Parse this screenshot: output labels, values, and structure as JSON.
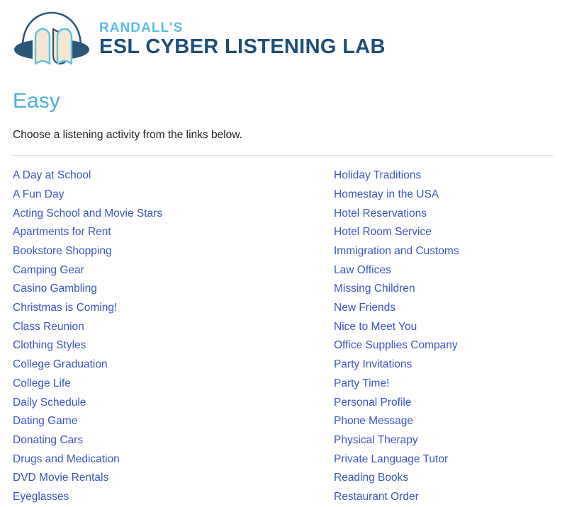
{
  "header": {
    "logo_icon": "headphones-books-logo",
    "brand_top": "RANDALL'S",
    "brand_main": "ESL CYBER LISTENING LAB",
    "colors": {
      "brand_top": "#5bbce4",
      "brand_main": "#1d4e79",
      "logo_dark": "#2a5678",
      "logo_light": "#5bc2e7",
      "logo_page_fill": "#f4e7d2"
    }
  },
  "main": {
    "title": "Easy",
    "title_color": "#4aafdb",
    "intro": "Choose a listening activity from the links below.",
    "link_color": "#3b55c4",
    "columns": [
      {
        "name": "left",
        "links": [
          "A Day at School",
          "A Fun Day",
          "Acting School and Movie Stars",
          "Apartments for Rent",
          "Bookstore Shopping",
          "Camping Gear",
          "Casino Gambling",
          "Christmas is Coming!",
          "Class Reunion",
          "Clothing Styles",
          "College Graduation",
          "College Life",
          "Daily Schedule",
          "Dating Game",
          "Donating Cars",
          "Drugs and Medication",
          "DVD Movie Rentals",
          "Eyeglasses"
        ]
      },
      {
        "name": "right",
        "links": [
          "Holiday Traditions",
          "Homestay in the USA",
          "Hotel Reservations",
          "Hotel Room Service",
          "Immigration and Customs",
          "Law Offices",
          "Missing Children",
          "New Friends",
          "Nice to Meet You",
          "Office Supplies Company",
          "Party Invitations",
          "Party Time!",
          "Personal Profile",
          "Phone Message",
          "Physical Therapy",
          "Private Language Tutor",
          "Reading Books",
          "Restaurant Order"
        ]
      }
    ]
  }
}
